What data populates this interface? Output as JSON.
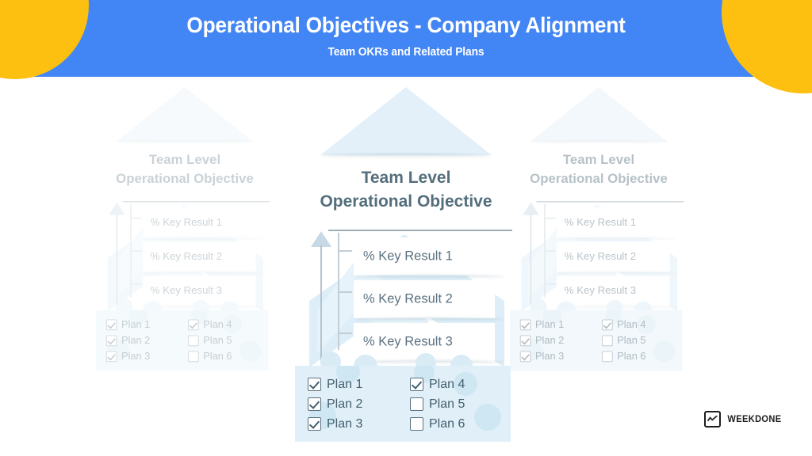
{
  "header": {
    "title": "Operational Objectives - Company Alignment",
    "subtitle": "Team OKRs and Related Plans",
    "bg_color": "#4285f4",
    "text_color": "#ffffff",
    "accent_circle_color": "#fdc010"
  },
  "columns": [
    {
      "id": "left",
      "state": "faded",
      "objective_line1": "Team Level",
      "objective_line2": "Operational Objective",
      "key_results": [
        "% Key Result 1",
        "% Key Result 2",
        "% Key Result 3"
      ],
      "plans": [
        {
          "label": "Plan 1",
          "checked": true
        },
        {
          "label": "Plan 4",
          "checked": true
        },
        {
          "label": "Plan 2",
          "checked": true
        },
        {
          "label": "Plan 5",
          "checked": false
        },
        {
          "label": "Plan 3",
          "checked": true
        },
        {
          "label": "Plan 6",
          "checked": false
        }
      ]
    },
    {
      "id": "center",
      "state": "active",
      "objective_line1": "Team Level",
      "objective_line2": "Operational Objective",
      "key_results": [
        "% Key Result 1",
        "% Key Result 2",
        "% Key Result 3"
      ],
      "plans": [
        {
          "label": "Plan 1",
          "checked": true
        },
        {
          "label": "Plan 4",
          "checked": true
        },
        {
          "label": "Plan 2",
          "checked": true
        },
        {
          "label": "Plan 5",
          "checked": false
        },
        {
          "label": "Plan 3",
          "checked": true
        },
        {
          "label": "Plan 6",
          "checked": false
        }
      ]
    },
    {
      "id": "right",
      "state": "faded",
      "objective_line1": "Team Level",
      "objective_line2": "Operational Objective",
      "key_results": [
        "% Key Result 1",
        "% Key Result 2",
        "% Key Result 3"
      ],
      "plans": [
        {
          "label": "Plan 1",
          "checked": true
        },
        {
          "label": "Plan 4",
          "checked": true
        },
        {
          "label": "Plan 2",
          "checked": true
        },
        {
          "label": "Plan 5",
          "checked": false
        },
        {
          "label": "Plan 3",
          "checked": true
        },
        {
          "label": "Plan 6",
          "checked": false
        }
      ]
    }
  ],
  "branding": {
    "wordmark": "WEEKDONE",
    "mark_icon": "chart-line-icon"
  },
  "palette": {
    "pyramid_fill": "#e3f0f9",
    "objective_text": "#546e7c",
    "key_result_text": "#5b7280",
    "plans_panel_bg": "#e1f0f8",
    "plan_text": "#44606e"
  }
}
